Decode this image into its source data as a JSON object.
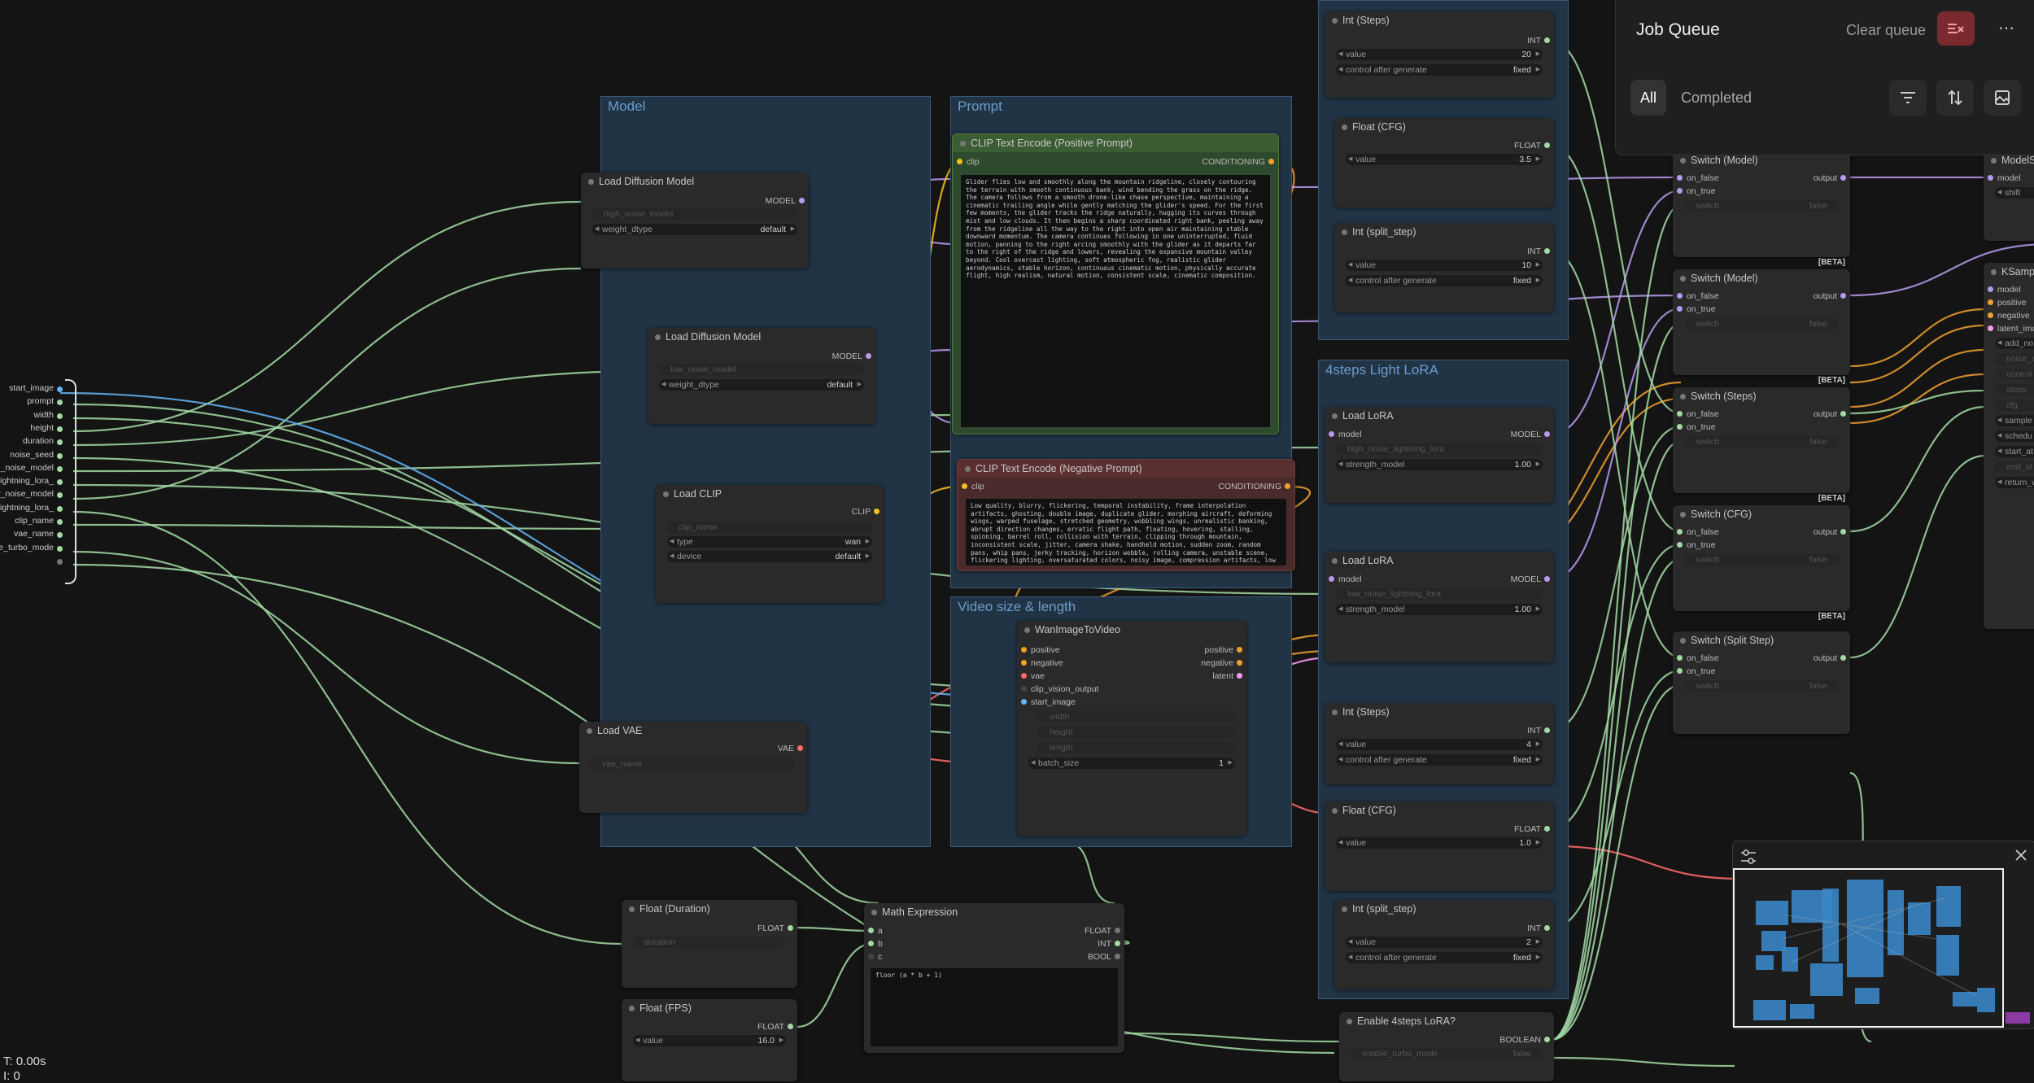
{
  "groups": {
    "model": "Model",
    "prompt": "Prompt",
    "video": "Video size & length",
    "lora": "4steps Light LoRA"
  },
  "inputs_panel": {
    "items": [
      "start_image",
      "prompt",
      "width",
      "height",
      "duration",
      "noise_seed",
      "high_noise_model",
      "high_lightning_lora",
      "low_noise_model",
      "low_lightning_lora",
      "clip_name",
      "vae_name",
      "enable_turbo_mode"
    ],
    "visible_labels": [
      "start_image",
      "prompt",
      "width",
      "height",
      "duration",
      "noise_seed",
      "h_noise_model",
      "_lightning_lora",
      "v_noise_model",
      "_lightning_lora",
      "clip_name",
      "vae_name",
      "e_turbo_mode"
    ]
  },
  "nodes": {
    "load_diffusion_1": {
      "title": "Load Diffusion Model",
      "output": "MODEL",
      "unet_name": "high_noise_model",
      "weight_dtype_label": "weight_dtype",
      "weight_dtype_value": "default"
    },
    "load_diffusion_2": {
      "title": "Load Diffusion Model",
      "output": "MODEL",
      "unet_name": "low_noise_model",
      "weight_dtype_label": "weight_dtype",
      "weight_dtype_value": "default"
    },
    "load_clip": {
      "title": "Load CLIP",
      "output": "CLIP",
      "clip_name": "clip_name",
      "type_label": "type",
      "type_value": "wan",
      "device_label": "device",
      "device_value": "default"
    },
    "load_vae": {
      "title": "Load VAE",
      "output": "VAE",
      "vae_name": "vae_name"
    },
    "clip_pos": {
      "title": "CLIP Text Encode (Positive Prompt)",
      "input": "clip",
      "output": "CONDITIONING",
      "text": "Glider flies low and smoothly along the mountain ridgeline, closely contouring the terrain with smooth continuous bank, wind bending the grass on the ridge. The camera follows from a smooth drone-like chase perspective, maintaining a cinematic trailing angle while gently matching the glider's speed. For the first few moments, the glider tracks the ridge naturally, hugging its curves through mist and low clouds. It then begins a sharp coordinated right bank, peeling away from the ridgeline all the way to the right into open air maintaining stable downward momentum. The camera continues following in one uninterrupted, fluid motion, panning to the right arcing smoothly with the glider as it departs far to the right of the ridge and lowers, revealing the expansive mountain valley beyond. Cool overcast lighting, soft atmospheric fog, realistic glider aerodynamics, stable horizon, continuous cinematic motion, physically accurate flight, high realism, natural motion, consistent scale, cinematic composition."
    },
    "clip_neg": {
      "title": "CLIP Text Encode (Negative Prompt)",
      "input": "clip",
      "output": "CONDITIONING",
      "text": "Low quality, blurry, flickering, temporal instability, frame interpolation artifacts, ghosting, double image, duplicate glider, morphing aircraft, deforming wings, warped fuselage, stretched geometry, wobbling wings, unrealistic banking, abrupt direction changes, erratic flight path, floating, hovering, stalling, spinning, barrel roll, collision with terrain, clipping through mountain, inconsistent scale, jitter, camera shake, handheld motion, sudden zoom, random pans, whip pans, jerky tracking, horizon wobble, rolling camera, unstable scene, flickering lighting, oversaturated colors, noisy image, compression artifacts, low resolution, excessive motion blur,"
    },
    "wan": {
      "title": "WanImageToVideo",
      "inputs": [
        "positive",
        "negative",
        "vae",
        "clip_vision_output",
        "start_image"
      ],
      "outputs": [
        "positive",
        "negative",
        "latent"
      ],
      "width": "width",
      "height": "height",
      "length": "length",
      "batch_label": "batch_size",
      "batch_value": "1"
    },
    "float_duration": {
      "title": "Float (Duration)",
      "output": "FLOAT",
      "value_name": "duration"
    },
    "float_fps": {
      "title": "Float (FPS)",
      "output": "FLOAT",
      "value_label": "value",
      "value": "16.0"
    },
    "math": {
      "title": "Math Expression",
      "inputs": [
        "a",
        "b",
        "c"
      ],
      "outputs": [
        "FLOAT",
        "INT",
        "BOOL"
      ],
      "expression": "floor (a * b + 1)"
    },
    "int_steps_1": {
      "title": "Int (Steps)",
      "output": "INT",
      "value_label": "value",
      "value": "20",
      "cag_label": "control after generate",
      "cag_value": "fixed"
    },
    "float_cfg_1": {
      "title": "Float (CFG)",
      "output": "FLOAT",
      "value_label": "value",
      "value": "3.5"
    },
    "int_split_1": {
      "title": "Int (split_step)",
      "output": "INT",
      "value_label": "value",
      "value": "10",
      "cag_label": "control after generate",
      "cag_value": "fixed"
    },
    "lora_1": {
      "title": "Load LoRA",
      "input": "model",
      "output": "MODEL",
      "lora_name": "high_noise_lightning_lora",
      "strength_label": "strength_model",
      "strength_value": "1.00"
    },
    "lora_2": {
      "title": "Load LoRA",
      "input": "model",
      "output": "MODEL",
      "lora_name": "low_noise_lightning_lora",
      "strength_label": "strength_model",
      "strength_value": "1.00"
    },
    "int_steps_2": {
      "title": "Int (Steps)",
      "output": "INT",
      "value_label": "value",
      "value": "4",
      "cag_label": "control after generate",
      "cag_value": "fixed"
    },
    "float_cfg_2": {
      "title": "Float (CFG)",
      "output": "FLOAT",
      "value_label": "value",
      "value": "1.0"
    },
    "int_split_2": {
      "title": "Int (split_step)",
      "output": "INT",
      "value_label": "value",
      "value": "2",
      "cag_label": "control after generate",
      "cag_value": "fixed"
    },
    "enable_4steps": {
      "title": "Enable 4steps LoRA?",
      "output": "BOOLEAN",
      "widget_name": "enable_turbo_mode",
      "widget_value": "false"
    },
    "switch_model_1": {
      "title": "Switch (Model)",
      "inputs": [
        "on_false",
        "on_true"
      ],
      "output": "output",
      "switch": "switch",
      "switch_value": "false",
      "badge": "[BETA]"
    },
    "switch_model_2": {
      "title": "Switch (Model)",
      "inputs": [
        "on_false",
        "on_true"
      ],
      "output": "output",
      "switch": "switch",
      "switch_value": "false",
      "badge": "[BETA]"
    },
    "switch_steps": {
      "title": "Switch (Steps)",
      "inputs": [
        "on_false",
        "on_true"
      ],
      "output": "output",
      "switch": "switch",
      "switch_value": "false",
      "badge": "[BETA]"
    },
    "switch_cfg": {
      "title": "Switch (CFG)",
      "inputs": [
        "on_false",
        "on_true"
      ],
      "output": "output",
      "switch": "switch",
      "switch_value": "false",
      "badge": "[BETA]"
    },
    "switch_split": {
      "title": "Switch (Split Step)",
      "inputs": [
        "on_false",
        "on_true"
      ],
      "output": "output",
      "switch": "switch",
      "switch_value": "false"
    },
    "model_sampling": {
      "title": "ModelS",
      "input": "model",
      "widget": "shift"
    },
    "ksampler": {
      "title": "KSampl",
      "inputs": [
        "model",
        "positive",
        "negative",
        "latent_ima"
      ],
      "widgets": [
        "add_no",
        "noise_se",
        "control",
        "steps",
        "cfg",
        "sample",
        "schedu",
        "start_at",
        "end_at",
        "return_w"
      ]
    }
  },
  "queue": {
    "title": "Job Queue",
    "clear_label": "Clear queue",
    "clear_icon": "clear-queue-icon",
    "more_icon": "more-icon",
    "tab_all": "All",
    "tab_completed": "Completed",
    "accent": "#7a2a2e"
  },
  "minimap": {
    "settings_icon": "sliders-icon",
    "close_icon": "close-icon"
  },
  "status": {
    "time": "T: 0.00s",
    "iter": "I: 0"
  },
  "colors": {
    "model": "#b79af0",
    "clip": "#f2c21b",
    "conditioning": "#f0a030",
    "vae": "#ff6b6b",
    "float": "#a3d9a5",
    "int": "#a3d9a5",
    "image": "#64b5f6",
    "latent": "#ff9cf9"
  }
}
